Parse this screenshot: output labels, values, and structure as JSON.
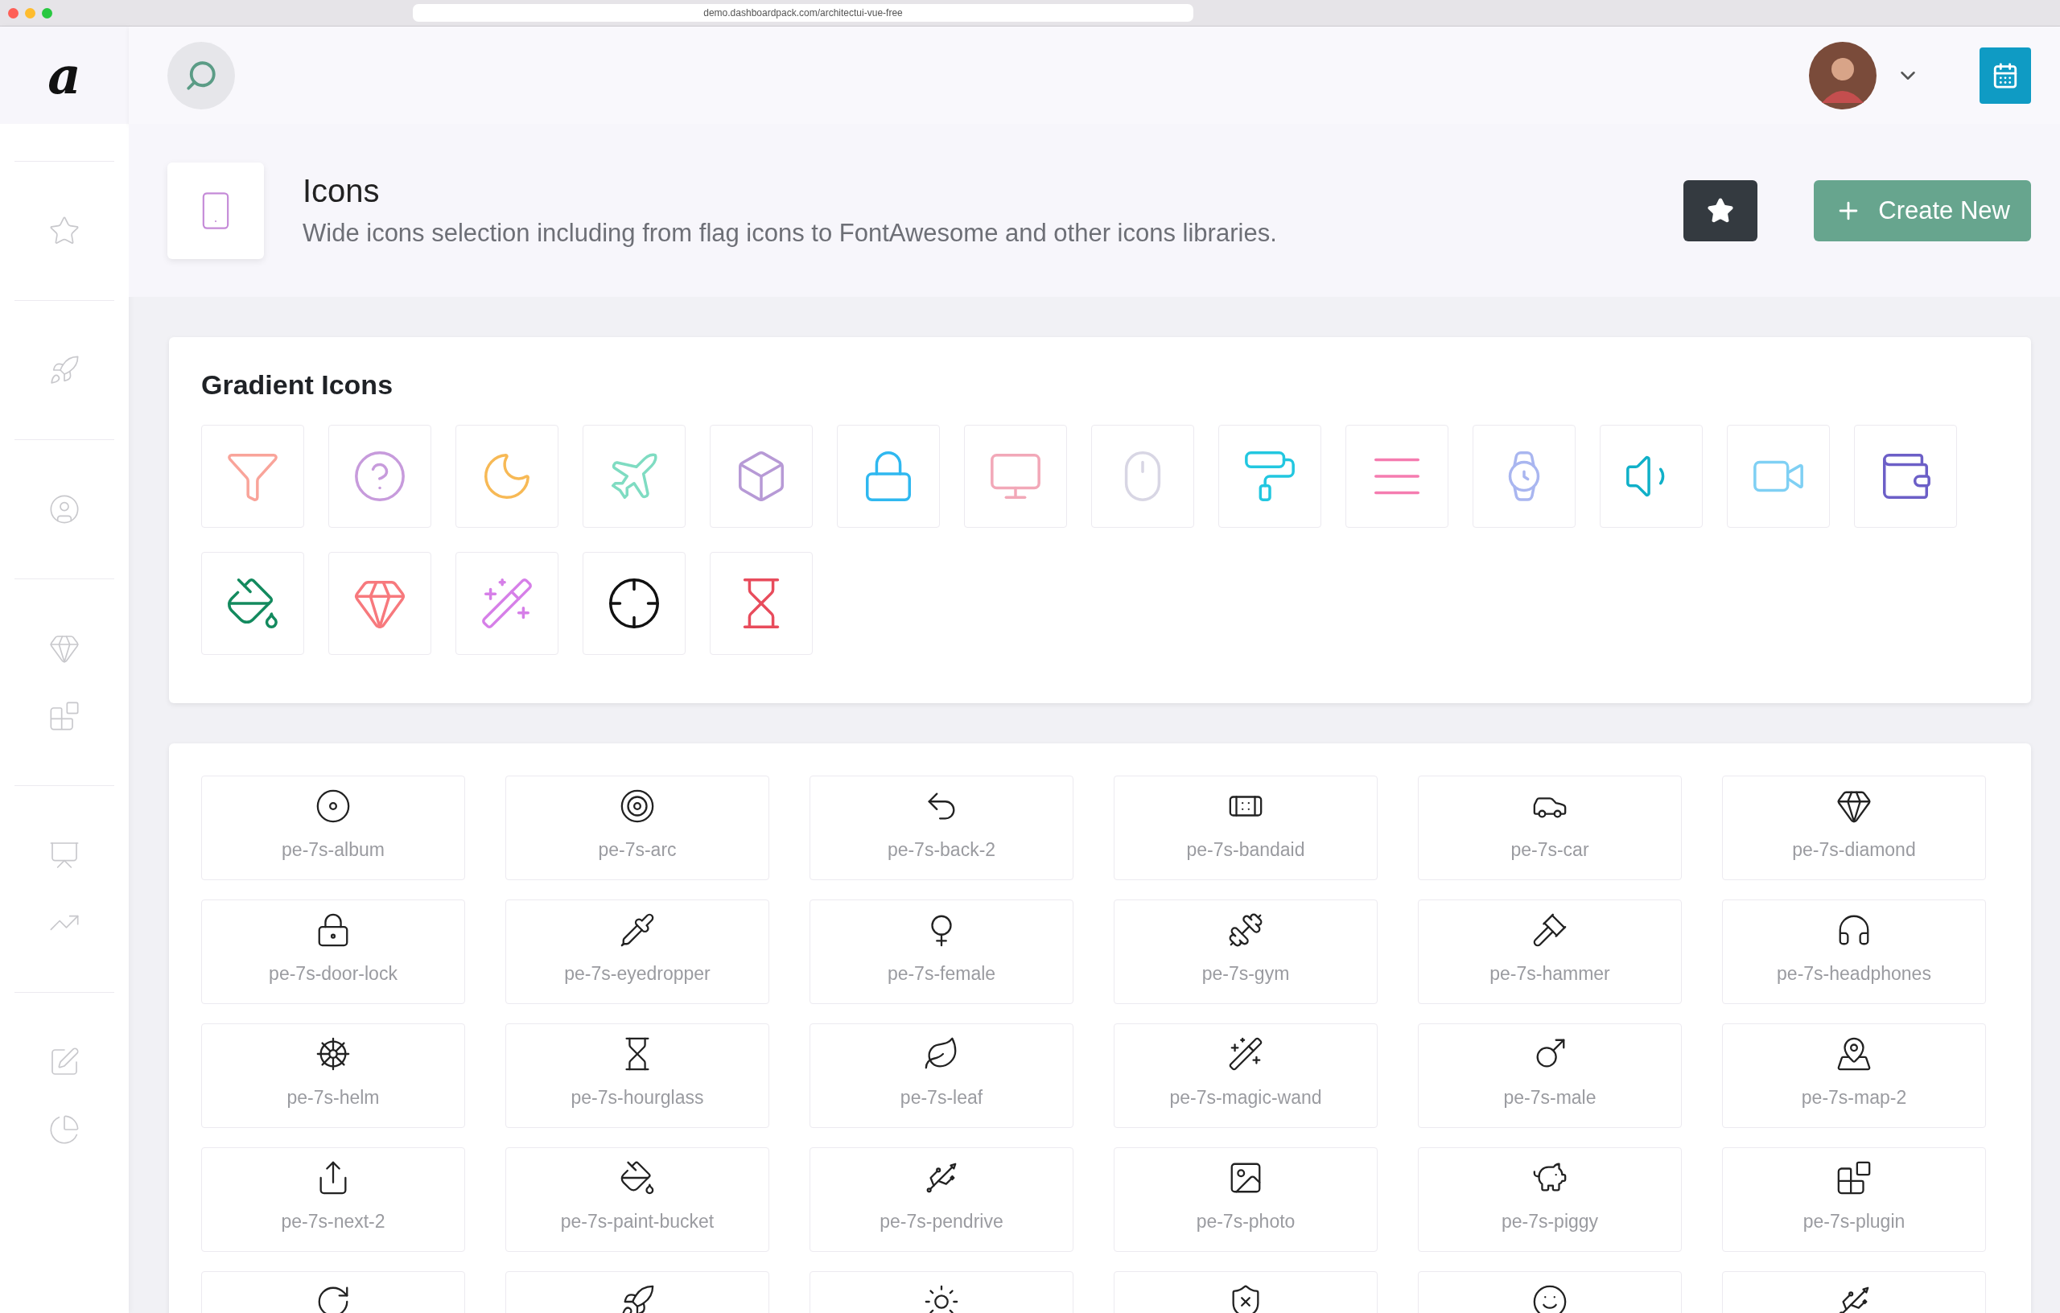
{
  "browser": {
    "url": "demo.dashboardpack.com/architectui-vue-free"
  },
  "logo": "a",
  "page_title": {
    "title": "Icons",
    "subtitle": "Wide icons selection including from flag icons to FontAwesome and other icons libraries."
  },
  "create_button": "Create New",
  "gradient_card": {
    "title": "Gradient Icons",
    "icons": [
      {
        "color": "#f9a49a"
      },
      {
        "color": "#c79bdc"
      },
      {
        "color": "#f7b955"
      },
      {
        "color": "#7fdcc2"
      },
      {
        "color": "#b79ad6"
      },
      {
        "color": "#2fb8f0"
      },
      {
        "color": "#f2a8b8"
      },
      {
        "color": "#d8d6e4"
      },
      {
        "color": "#22c7e0"
      },
      {
        "color": "#f57cb0"
      },
      {
        "color": "#a9b6f0"
      },
      {
        "color": "#10b0c8"
      },
      {
        "color": "#7fd0f4"
      },
      {
        "color": "#6c5fc7"
      },
      {
        "color": "#138a5e"
      },
      {
        "color": "#f7797d"
      },
      {
        "color": "#d67fe8"
      },
      {
        "color": "#111111"
      },
      {
        "color": "#e84c5c"
      }
    ]
  },
  "icon_grid": [
    {
      "kind": "tile",
      "label": "pe-7s-album"
    },
    {
      "kind": "tile",
      "label": "pe-7s-arc"
    },
    {
      "kind": "tile",
      "label": "pe-7s-back-2"
    },
    {
      "kind": "tile",
      "label": "pe-7s-bandaid"
    },
    {
      "kind": "tile",
      "label": "pe-7s-car"
    },
    {
      "kind": "tile",
      "label": "pe-7s-diamond"
    },
    {
      "kind": "tile",
      "label": "pe-7s-door-lock"
    },
    {
      "kind": "tile",
      "label": "pe-7s-eyedropper"
    },
    {
      "kind": "tile",
      "label": "pe-7s-female"
    },
    {
      "kind": "tile",
      "label": "pe-7s-gym"
    },
    {
      "kind": "tile",
      "label": "pe-7s-hammer"
    },
    {
      "kind": "tile",
      "label": "pe-7s-headphones"
    },
    {
      "kind": "tile",
      "label": "pe-7s-helm"
    },
    {
      "kind": "tile",
      "label": "pe-7s-hourglass"
    },
    {
      "kind": "tile",
      "label": "pe-7s-leaf"
    },
    {
      "kind": "tile",
      "label": "pe-7s-magic-wand"
    },
    {
      "kind": "tile",
      "label": "pe-7s-male"
    },
    {
      "kind": "tile",
      "label": "pe-7s-map-2"
    },
    {
      "kind": "tile",
      "label": "pe-7s-next-2"
    },
    {
      "kind": "tile",
      "label": "pe-7s-paint-bucket"
    },
    {
      "kind": "tile",
      "label": "pe-7s-pendrive"
    },
    {
      "kind": "tile",
      "label": "pe-7s-photo"
    },
    {
      "kind": "tile",
      "label": "pe-7s-piggy"
    },
    {
      "kind": "tile",
      "label": "pe-7s-plugin"
    },
    {
      "kind": "partial"
    },
    {
      "kind": "partial"
    },
    {
      "kind": "partial"
    },
    {
      "kind": "partial"
    },
    {
      "kind": "partial"
    },
    {
      "kind": "partial"
    }
  ]
}
